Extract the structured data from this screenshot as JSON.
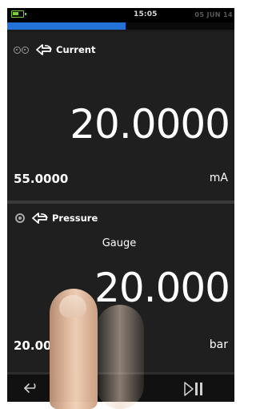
{
  "status": {
    "time": "15:05",
    "date": "05 JUN 14",
    "battery_level": 0.6,
    "progress": 0.52
  },
  "panels": [
    {
      "label": "Current",
      "mode_icon": "source-arrow-icon",
      "value": "20.0000",
      "secondary_value": "55.0000",
      "unit": "mA"
    },
    {
      "label": "Pressure",
      "mode_icon": "source-arrow-icon",
      "sub_label": "Gauge",
      "value": "20.000",
      "secondary_value": "20.00",
      "unit": "bar"
    }
  ],
  "bottom_bar": {
    "back_icon": "back-arrow-icon",
    "run_icon": "play-pause-icon"
  },
  "colors": {
    "accent": "#2372d8",
    "battery": "#7ccf3a",
    "background": "#1f1f1f"
  }
}
